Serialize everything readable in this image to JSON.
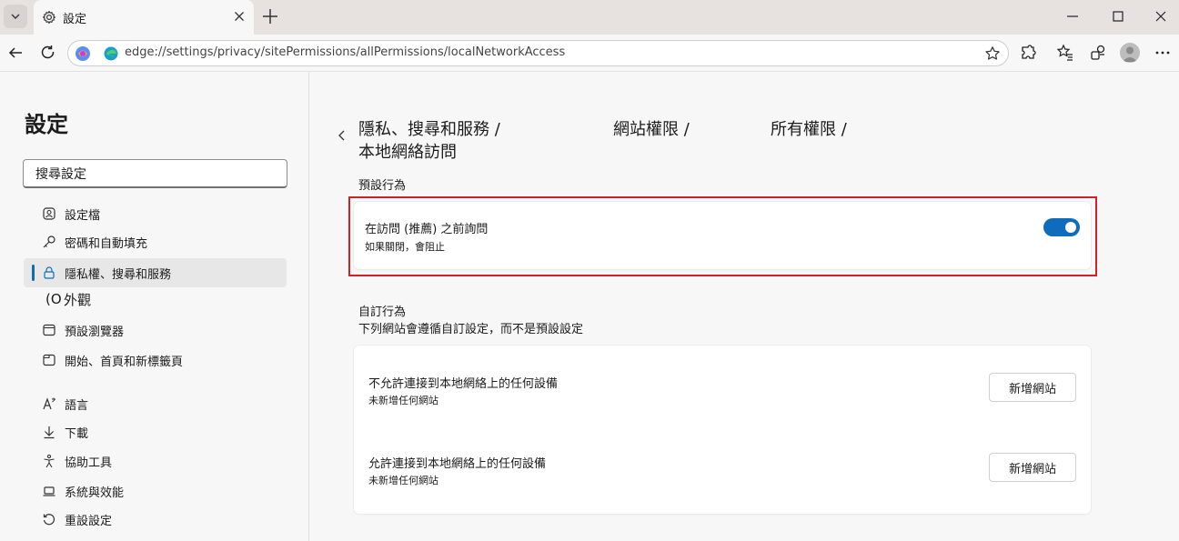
{
  "tab": {
    "title": "設定"
  },
  "address": {
    "url": "edge://settings/privacy/sitePermissions/allPermissions/localNetworkAccess"
  },
  "sidebar": {
    "title": "設定",
    "search_value": "搜尋設定",
    "items": [
      {
        "label": "設定檔",
        "icon": "profile-icon"
      },
      {
        "label": "密碼和自動填充",
        "icon": "key-icon"
      },
      {
        "label": "隱私權、搜尋和服務",
        "icon": "lock-icon",
        "active": true
      },
      {
        "prefix": "(O",
        "label": "外觀",
        "icon": "appearance-icon"
      },
      {
        "label": "預設瀏覽器",
        "icon": "browser-icon"
      },
      {
        "label": "開始、首頁和新標籤頁",
        "icon": "home-page-icon"
      },
      {
        "label": "語言",
        "icon": "language-icon"
      },
      {
        "label": "下載",
        "icon": "download-icon"
      },
      {
        "label": "協助工具",
        "icon": "accessibility-icon"
      },
      {
        "label": "系統與效能",
        "icon": "laptop-icon"
      },
      {
        "label": "重設設定",
        "icon": "reset-icon"
      }
    ]
  },
  "breadcrumb": {
    "level1": "隱私、搜尋和服務 /",
    "level2": "網站權限 /",
    "level3": "所有權限 /",
    "current": "本地網絡訪問"
  },
  "default_behavior": {
    "heading": "預設行為",
    "title": "在訪問 (推薦) 之前詢問",
    "subtitle": "如果關閉，會阻止",
    "toggle_on": true
  },
  "custom_behavior": {
    "heading": "自訂行為",
    "description": "下列網站會遵循自訂設定，而不是預設設定",
    "block": {
      "title": "不允許連接到本地網絡上的任何設備",
      "subtitle": "未新增任何網站",
      "button": "新增網站"
    },
    "allow": {
      "title": "允許連接到本地網絡上的任何設備",
      "subtitle": "未新增任何網站",
      "button": "新增網站"
    }
  },
  "colors": {
    "accent": "#0f6cbd",
    "highlight_border": "#d1202a"
  }
}
